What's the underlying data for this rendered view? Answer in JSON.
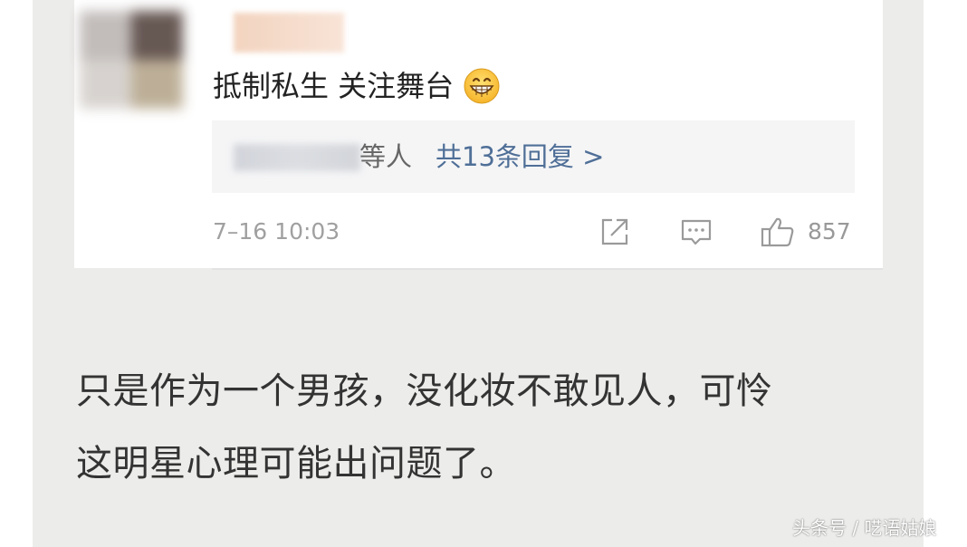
{
  "comment": {
    "text": "抵制私生 关注舞台",
    "emoji_icon": "grinning-face-icon",
    "reply_summary": {
      "suffix": "等人",
      "link_text": "共13条回复 >"
    },
    "timestamp": "7–16 10:03",
    "actions": {
      "share_icon": "share-icon",
      "comment_icon": "comment-icon",
      "like_icon": "thumbs-up-icon",
      "like_count": "857"
    }
  },
  "article": {
    "lines": [
      "只是作为一个男孩，没化妆不敢见人，可怜",
      "这明星心理可能出问题了。"
    ]
  },
  "watermark": "头条号 / 呓语姑娘",
  "colors": {
    "article_background": "#ececea",
    "card_background": "#ffffff",
    "reply_background": "#f5f5f6",
    "link_blue": "#4f6f97",
    "muted_gray": "#a0a0a0",
    "body_text": "#333333"
  }
}
